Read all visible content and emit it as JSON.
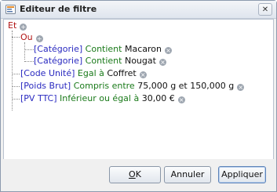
{
  "window": {
    "title": "Editeur de filtre",
    "close_glyph": "✕"
  },
  "tree": {
    "root": {
      "operator": "Et",
      "add_glyph": "+"
    },
    "group": {
      "operator": "Ou",
      "add_glyph": "+"
    },
    "rows": [
      {
        "field": "[Catégorie]",
        "condition": "Contient",
        "value": "Macaron"
      },
      {
        "field": "[Catégorie]",
        "condition": "Contient",
        "value": "Nougat"
      },
      {
        "field": "[Code Unité]",
        "condition": "Egal à",
        "value": "Coffret"
      },
      {
        "field": "[Poids Brut]",
        "condition": "Compris entre",
        "value": "75,000 g et 150,000 g"
      },
      {
        "field": "[PV TTC]",
        "condition": "Inférieur ou égal à",
        "value": "30,00 €"
      }
    ],
    "remove_glyph": "×"
  },
  "buttons": {
    "ok_mnemonic": "O",
    "ok_rest": "K",
    "cancel": "Annuler",
    "apply": "Appliquer"
  }
}
